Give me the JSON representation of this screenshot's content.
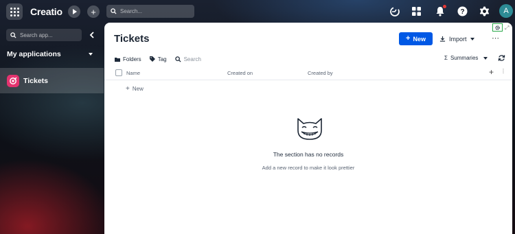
{
  "topbar": {
    "brand": "Creatio",
    "search_placeholder": "Search...",
    "avatar_initial": "A"
  },
  "sidebar": {
    "search_placeholder": "Search app...",
    "section_title": "My applications",
    "items": [
      {
        "label": "Tickets",
        "icon": "tickets-app-icon",
        "color": "#e4336f",
        "active": true
      }
    ]
  },
  "page": {
    "title": "Tickets",
    "new_button": "New",
    "import_button": "Import",
    "toolbar": {
      "folders": "Folders",
      "tag": "Tag",
      "search_placeholder": "Search",
      "summaries": "Summaries"
    },
    "columns": [
      "Name",
      "Created on",
      "Created by"
    ],
    "add_row_label": "New",
    "empty": {
      "title": "The section has no records",
      "subtitle": "Add a new record to make it look prettier"
    }
  },
  "colors": {
    "primary": "#0058e5",
    "app_accent": "#e4336f",
    "avatar": "#2d8b95",
    "notification": "#e53935",
    "highlight_box": "#2ba84a"
  }
}
